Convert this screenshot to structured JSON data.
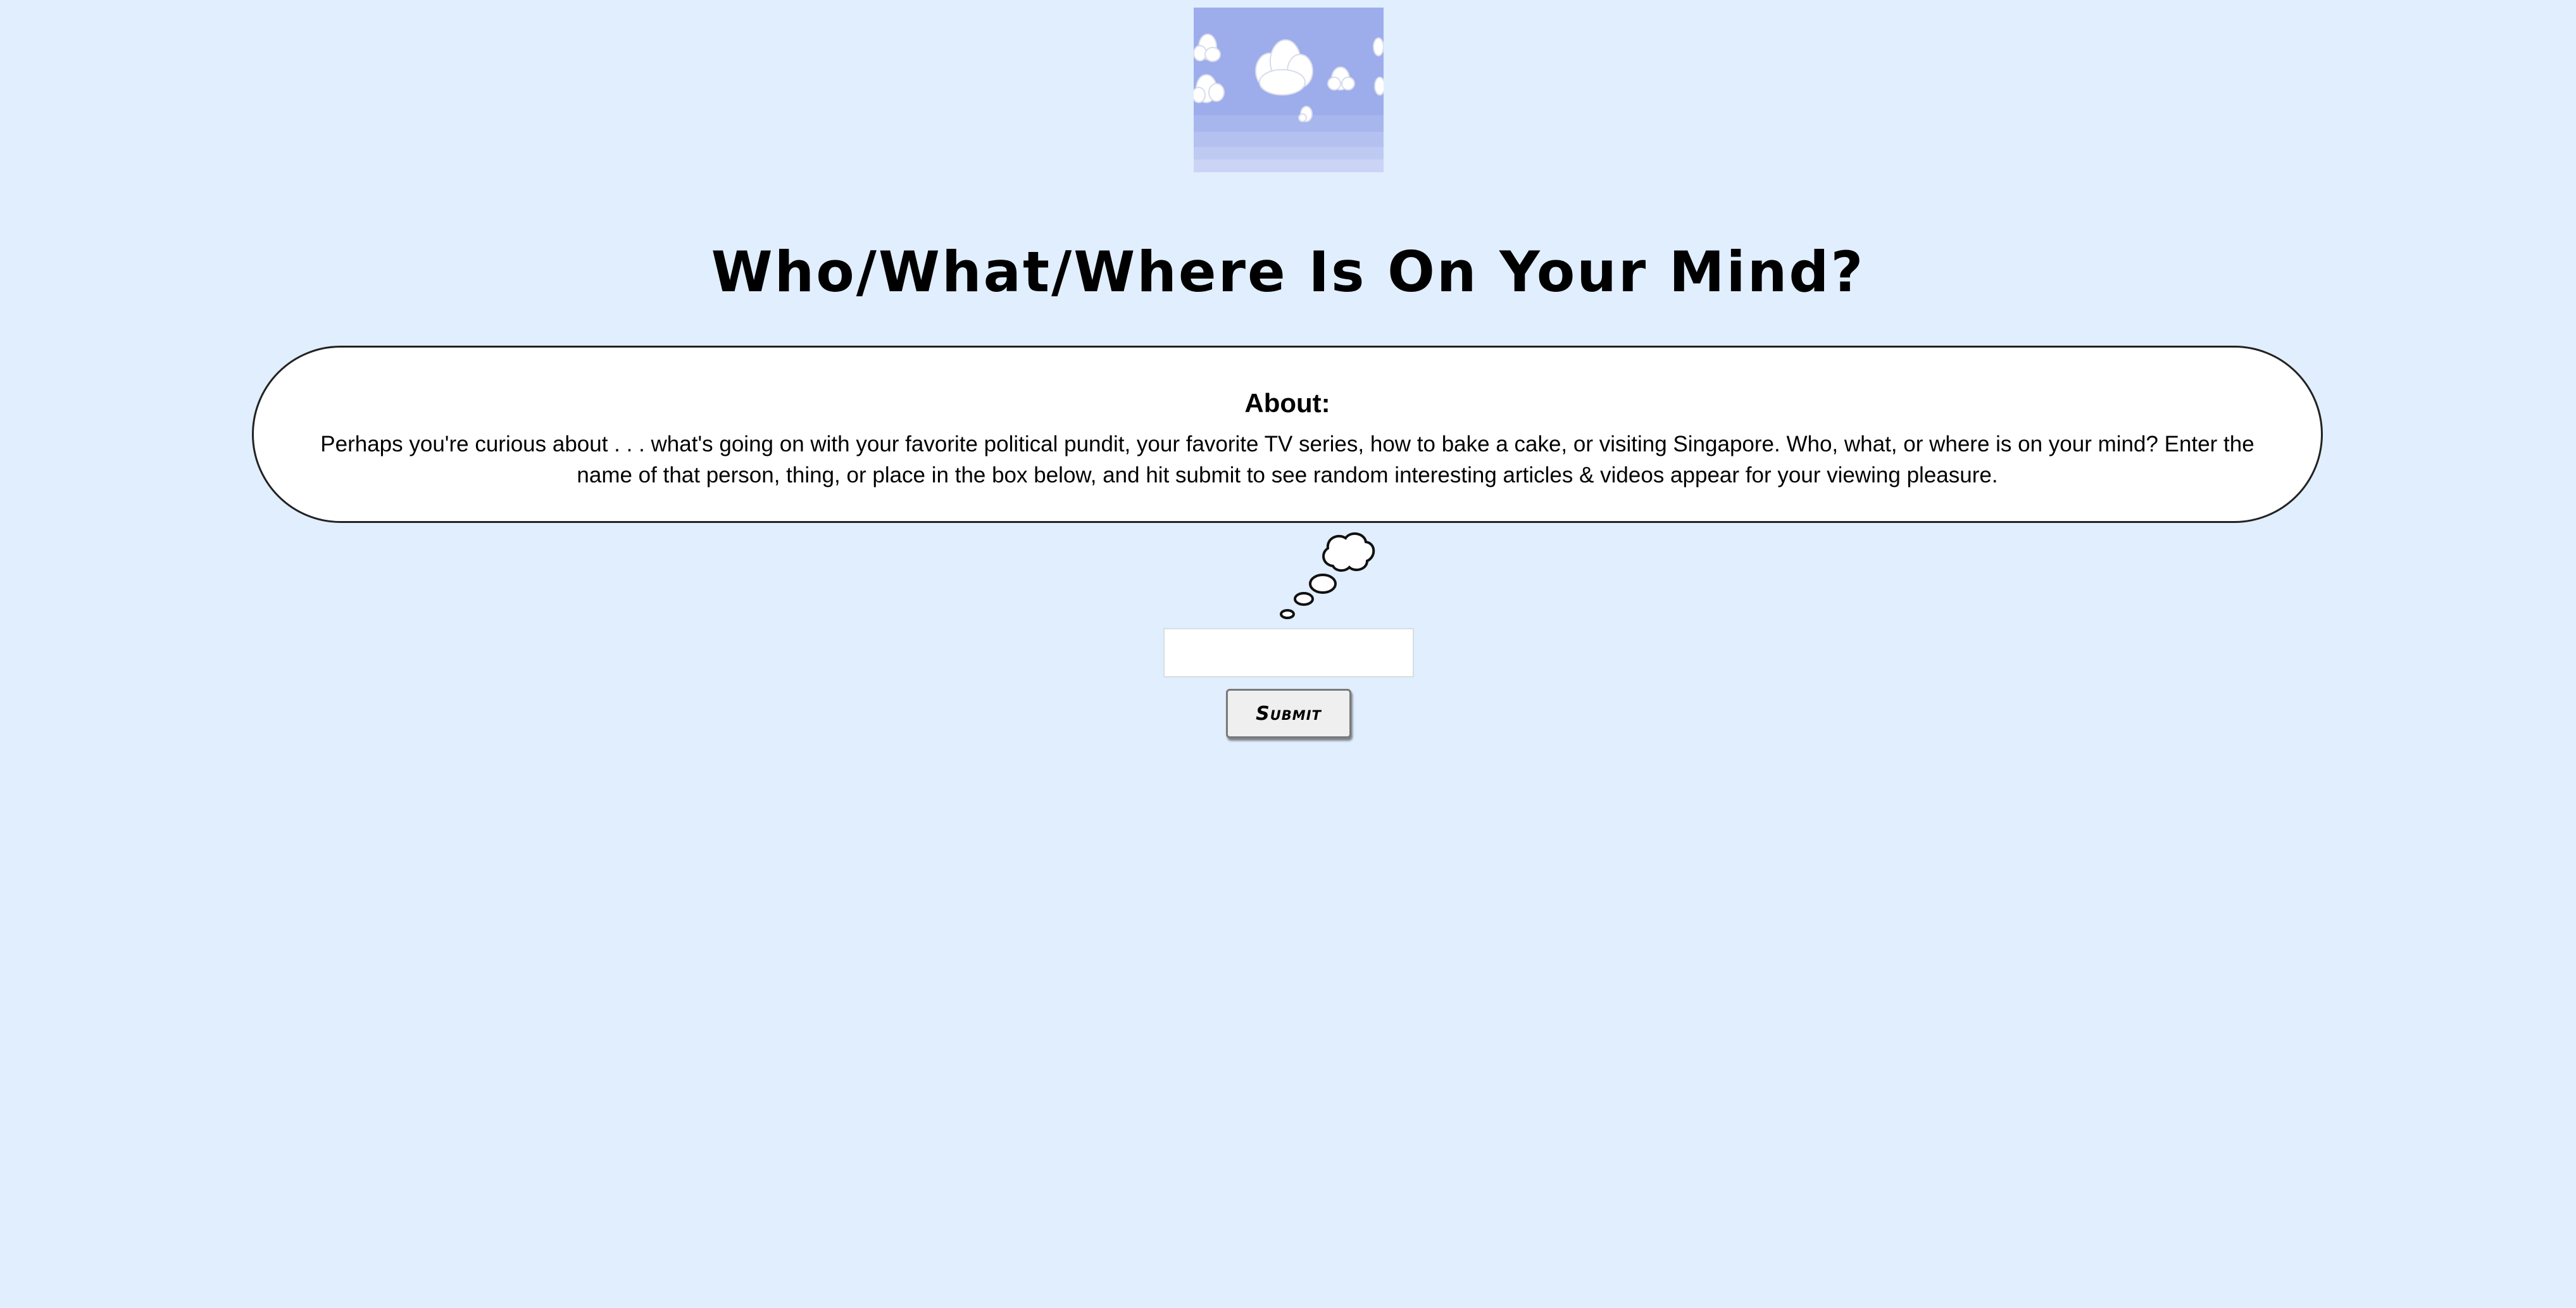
{
  "header": {
    "image_icon": "cloudy-sky-image",
    "title": "Who/What/Where Is On Your Mind?"
  },
  "about": {
    "heading": "About:",
    "text": "Perhaps you're curious about . . . what's going on with your favorite political pundit, your favorite TV series, how to bake a cake, or visiting Singapore. Who, what, or where is on your mind? Enter the name of that person, thing, or place in the box below, and hit submit to see random interesting articles & videos appear for your viewing pleasure."
  },
  "search": {
    "value": "",
    "placeholder": "",
    "thought_icon": "thought-bubble-icon",
    "submit_label": "Submit"
  },
  "colors": {
    "background": "#e0eefd",
    "sky": "#9dadeb",
    "box": "#ffffff"
  }
}
